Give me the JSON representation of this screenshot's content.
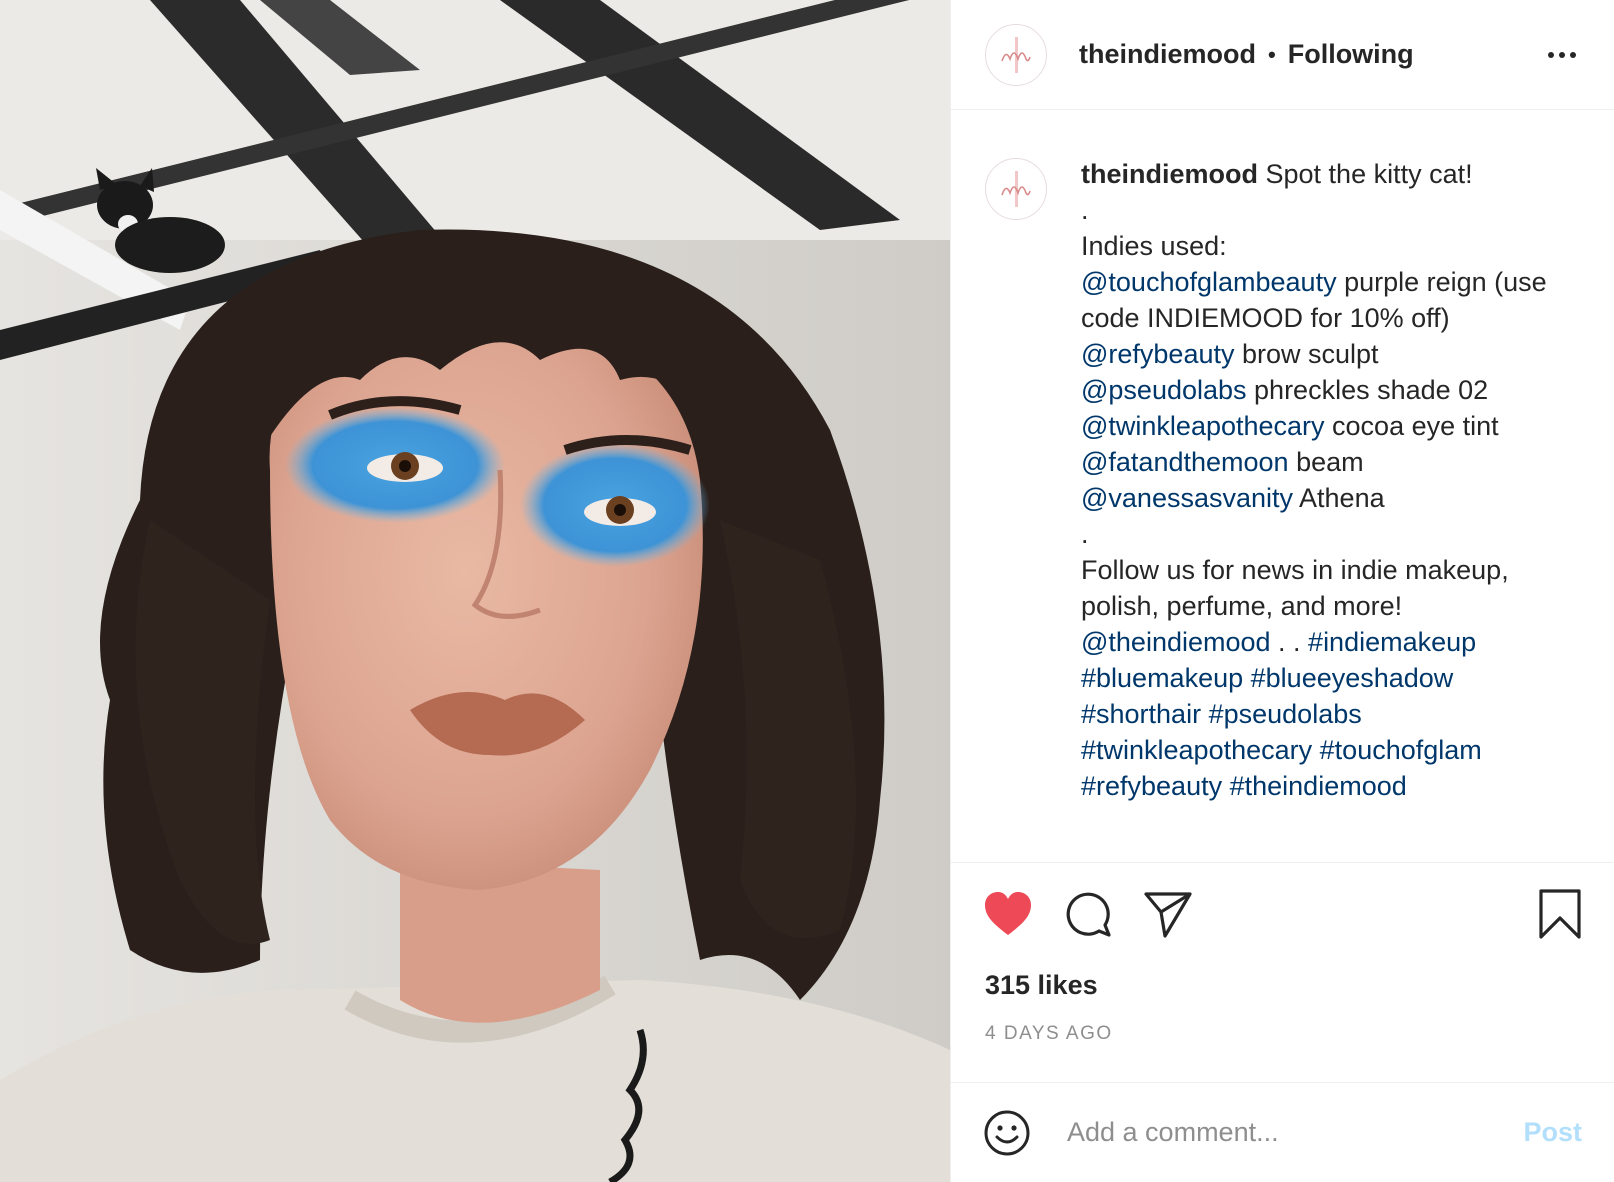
{
  "header": {
    "username": "theindiemood",
    "separator": "•",
    "follow_status": "Following"
  },
  "caption": {
    "username": "theindiemood",
    "lines": [
      {
        "text": " Spot the kitty cat!"
      },
      {
        "text": "."
      },
      {
        "text": "Indies used:"
      },
      {
        "mention": "@touchofglambeauty",
        "text": " purple reign (use"
      },
      {
        "text": "code INDIEMOOD for 10% off)"
      },
      {
        "mention": "@refybeauty",
        "text": " brow sculpt"
      },
      {
        "mention": "@pseudolabs",
        "text": " phreckles shade 02"
      },
      {
        "mention": "@twinkleapothecary",
        "text": " cocoa eye tint"
      },
      {
        "mention": "@fatandthemoon",
        "text": " beam"
      },
      {
        "mention": "@vanessasvanity",
        "text": " Athena"
      },
      {
        "text": "."
      },
      {
        "text": "Follow us for news in indie makeup,"
      },
      {
        "text": "polish, perfume, and more!"
      }
    ],
    "mention_line": {
      "mention": "@theindiemood",
      "text": " . . ",
      "tag": "#indiemakeup"
    },
    "hashtag_lines": [
      [
        "#bluemakeup",
        "#blueeyeshadow"
      ],
      [
        "#shorthair",
        "#pseudolabs"
      ],
      [
        "#twinkleapothecary",
        "#touchofglam"
      ],
      [
        "#refybeauty",
        "#theindiemood"
      ]
    ],
    "age": "4d"
  },
  "actions": {
    "icons": [
      "heart-icon",
      "comment-icon",
      "share-icon",
      "bookmark-icon"
    ],
    "liked": true,
    "like_color": "#ed4956"
  },
  "likes": "315 likes",
  "posted": "4 DAYS AGO",
  "comment_box": {
    "placeholder": "Add a comment...",
    "post_label": "Post"
  },
  "colors": {
    "link": "#00376b",
    "muted": "#8e8e8e",
    "post_disabled": "#b2dffc"
  }
}
